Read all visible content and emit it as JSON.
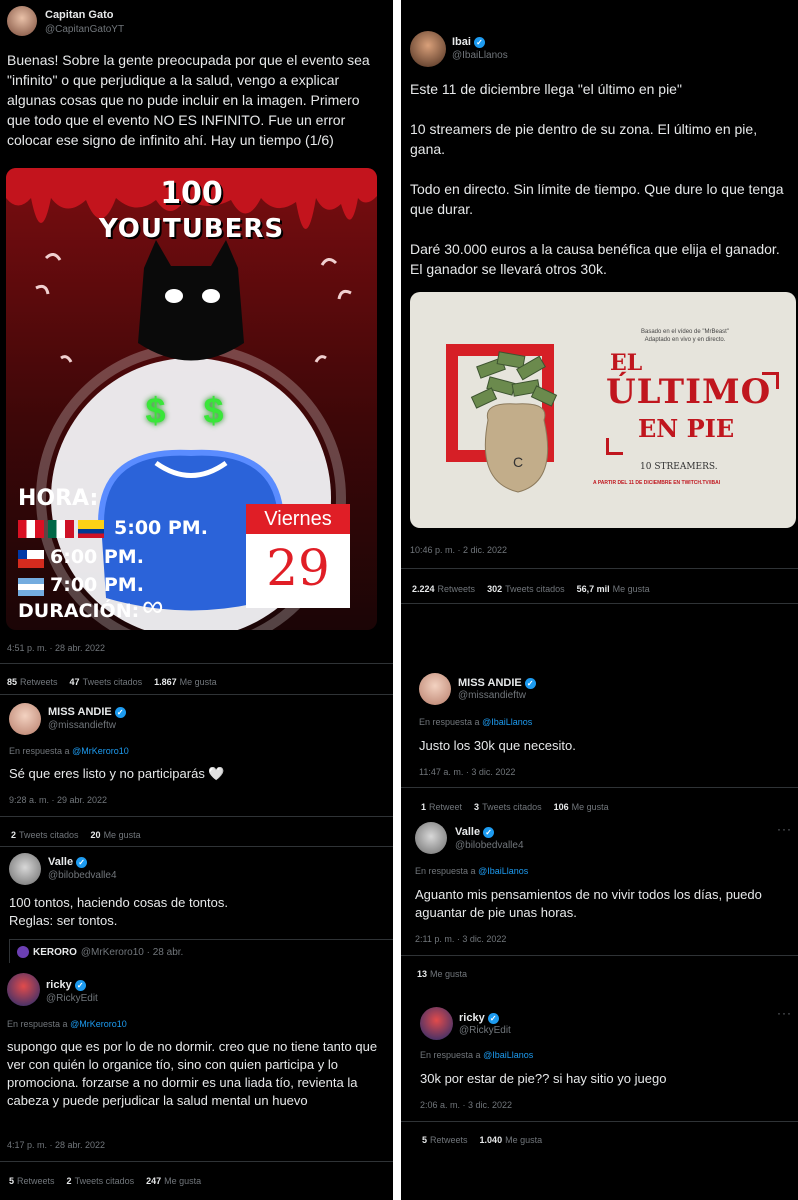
{
  "left": {
    "main": {
      "name": "Capitan Gato",
      "handle": "@CapitanGatoYT",
      "text": "Buenas! Sobre la gente preocupada por que el evento sea \"infinito\" o que perjudique a la salud, vengo a explicar algunas cosas que no pude incluir en la imagen. Primero que todo que el evento NO ES INFINITO. Fue un error colocar ese signo de infinito ahí. Hay un tiempo (1/6)",
      "poster": {
        "title_top": "100",
        "title_bottom": "YOUTUBERS",
        "hora_label": "HORA:",
        "time1": "5:00 PM.",
        "time2": "6:00 PM.",
        "time3": "7:00 PM.",
        "duracion_label": "DURACIÓN:",
        "infinity": "∞",
        "day": "Viernes",
        "date": "29",
        "dollar": "$ $"
      },
      "time": "4:51 p. m. · 28 abr. 2022",
      "stats": {
        "retweets": "85",
        "retweets_label": "Retweets",
        "quotes": "47",
        "quotes_label": "Tweets citados",
        "likes": "1.867",
        "likes_label": "Me gusta"
      }
    },
    "reply1": {
      "name": "MISS ANDIE",
      "handle": "@missandieftw",
      "reply_prefix": "En respuesta a",
      "reply_to": "@MrKeroro10",
      "text": "Sé que eres listo y no participarás 🤍",
      "time": "9:28 a. m. · 29 abr. 2022",
      "stats": {
        "quotes": "2",
        "quotes_label": "Tweets citados",
        "likes": "20",
        "likes_label": "Me gusta"
      }
    },
    "reply2": {
      "name": "Valle",
      "handle": "@bilobedvalle4",
      "text": "100 tontos, haciendo cosas de tontos.\nReglas: ser tontos.",
      "quoted_name": "KERORO",
      "quoted_handle": "@MrKeroro10 · 28 abr."
    },
    "reply3": {
      "name": "ricky",
      "handle": "@RickyEdit",
      "reply_prefix": "En respuesta a",
      "reply_to": "@MrKeroro10",
      "text": "supongo que es por lo de no dormir. creo que no tiene tanto que ver con quién lo organice tío, sino con quien participa y lo promociona. forzarse a no dormir es una liada tío, revienta la cabeza y puede perjudicar la salud mental un huevo",
      "time": "4:17 p. m. · 28 abr. 2022",
      "stats": {
        "retweets": "5",
        "retweets_label": "Retweets",
        "quotes": "2",
        "quotes_label": "Tweets citados",
        "likes": "247",
        "likes_label": "Me gusta"
      }
    }
  },
  "right": {
    "main": {
      "name": "Ibai",
      "handle": "@IbaiLlanos",
      "text": "Este 11 de diciembre llega \"el último en pie\"\n\n10 streamers de pie dentro de su zona. El último en pie, gana.\n\nTodo en directo. Sin límite de tiempo. Que dure lo que tenga que durar.\n\nDaré 30.000 euros a la causa benéfica que elija el ganador. El ganador se llevará otros 30k.",
      "poster": {
        "caption": "Basado en el vídeo de \"MrBeast\"\nAdaptado en vivo y en directo.",
        "title1": "EL",
        "title2": "ÚLTIMO",
        "title3": "EN PIE",
        "streamers": "10 STREAMERS.",
        "date_line": "A PARTIR DEL 11 DE DICIEMBRE EN TWITCH.TV/IBAI"
      },
      "time": "10:46 p. m. · 2 dic. 2022",
      "stats": {
        "retweets": "2.224",
        "retweets_label": "Retweets",
        "quotes": "302",
        "quotes_label": "Tweets citados",
        "likes": "56,7 mil",
        "likes_label": "Me gusta"
      }
    },
    "reply1": {
      "name": "MISS ANDIE",
      "handle": "@missandieftw",
      "reply_prefix": "En respuesta a",
      "reply_to": "@IbaiLlanos",
      "text": "Justo los 30k que necesito.",
      "time": "11:47 a. m. · 3 dic. 2022",
      "stats": {
        "retweets": "1",
        "retweets_label": "Retweet",
        "quotes": "3",
        "quotes_label": "Tweets citados",
        "likes": "106",
        "likes_label": "Me gusta"
      }
    },
    "reply2": {
      "name": "Valle",
      "handle": "@bilobedvalle4",
      "reply_prefix": "En respuesta a",
      "reply_to": "@IbaiLlanos",
      "text": "Aguanto mis pensamientos de no vivir todos los días, puedo aguantar de pie unas horas.",
      "time": "2:11 p. m. · 3 dic. 2022",
      "stats": {
        "likes": "13",
        "likes_label": "Me gusta"
      }
    },
    "reply3": {
      "name": "ricky",
      "handle": "@RickyEdit",
      "reply_prefix": "En respuesta a",
      "reply_to": "@IbaiLlanos",
      "text": "30k por estar de pie?? si hay sitio yo juego",
      "time": "2:06 a. m. · 3 dic. 2022",
      "stats": {
        "retweets": "5",
        "retweets_label": "Retweets",
        "likes": "1.040",
        "likes_label": "Me gusta"
      }
    }
  },
  "icons": {
    "verified": "verified-badge-icon",
    "more": "more-options-icon"
  },
  "colors": {
    "link": "#1d9bf0",
    "muted": "#71767b",
    "poster_red": "#b5121b"
  }
}
